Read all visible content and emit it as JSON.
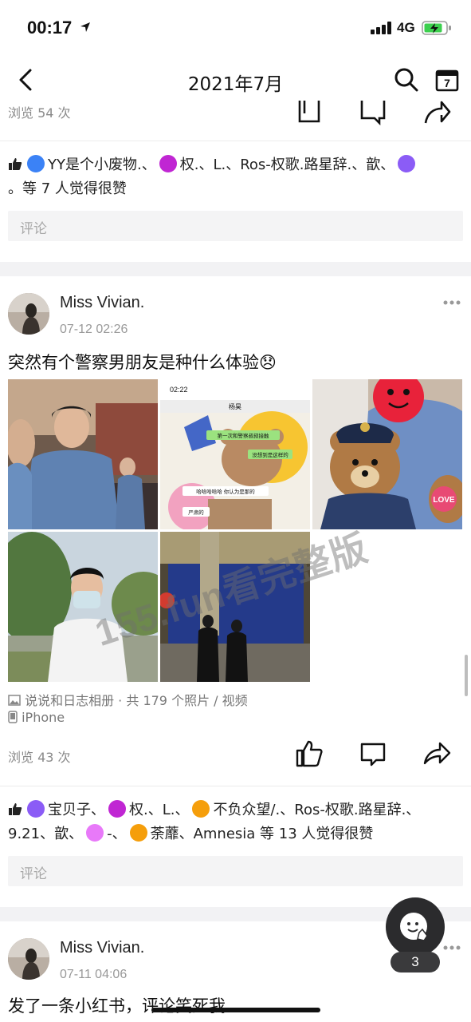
{
  "status_bar": {
    "time": "00:17",
    "network": "4G"
  },
  "nav": {
    "title": "2021年7月",
    "calendar_day": "7"
  },
  "post_prev": {
    "views": "浏览 54 次",
    "likes_name_1": "YY是个小废物.、",
    "likes_name_2": "权.、L.、Ros-权歌.路星辞.、歆、",
    "likes_line_2": "。等 7 人觉得很赞",
    "comment_placeholder": "评论"
  },
  "post_main": {
    "author": "Miss Vivian.",
    "time": "07-12 02:26",
    "text": "突然有个警察男朋友是种什么体验😞",
    "album": "说说和日志相册 · 共 179 个照片 / 视频",
    "device": "iPhone",
    "views": "浏览 43 次",
    "likes_1": "宝贝子、",
    "likes_2": "权.、L.、",
    "likes_3": "不负众望/.、Ros-权歌.路星辞.、",
    "likes_line_2a": "9.21、歆、",
    "likes_line_2b": "-、",
    "likes_line_2c": "荼蘼、Amnesia 等 13 人觉得很赞",
    "comment_placeholder": "评论",
    "chat_time": "02:22",
    "chat_name": "杨昊",
    "chat_bubble_1": "第一次和警察叔叔接触",
    "chat_bubble_2": "没想到是这样的",
    "chat_bubble_3": "哈哈哈哈哈   你认为是那的",
    "chat_bubble_4": "严肃的",
    "bear_badge": "LOVE"
  },
  "post_next": {
    "author": "Miss Vivian.",
    "time": "07-11 04:06",
    "text": "发了一条小红书，评论笑死我"
  },
  "watermark": "155.fun看完整版",
  "fab": {
    "badge": "3"
  },
  "colors": {
    "accent_blue": "#3b82f6",
    "purple": "#8b5cf6",
    "magenta": "#c026d3",
    "orange": "#f59e0b",
    "page_bg": "#ffffff",
    "section_gap": "#f2f2f4"
  }
}
